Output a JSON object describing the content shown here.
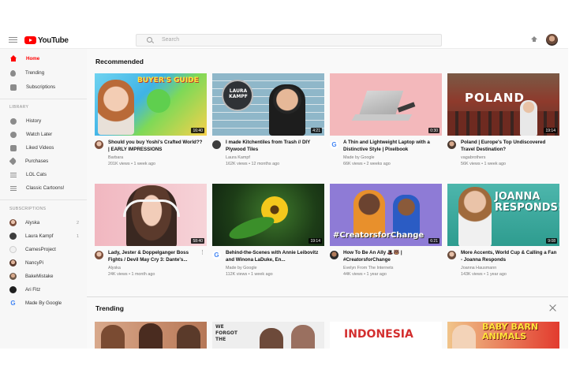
{
  "header": {
    "logo_text": "YouTube",
    "search_placeholder": "Search",
    "icons": [
      "menu-icon",
      "search-icon",
      "upload-icon",
      "avatar"
    ]
  },
  "colors": {
    "brand_red": "#ff0000",
    "sidebar_bg": "#f7f7f7",
    "text": "#111111",
    "muted": "#777777"
  },
  "sidebar": {
    "main": [
      {
        "label": "Home",
        "icon": "home-icon",
        "active": true
      },
      {
        "label": "Trending",
        "icon": "flame-icon"
      },
      {
        "label": "Subscriptions",
        "icon": "subscriptions-icon"
      }
    ],
    "library_heading": "LIBRARY",
    "library": [
      {
        "label": "History",
        "icon": "history-icon"
      },
      {
        "label": "Watch Later",
        "icon": "clock-icon"
      },
      {
        "label": "Liked Videos",
        "icon": "thumb-up-icon"
      },
      {
        "label": "Purchases",
        "icon": "tag-icon"
      },
      {
        "label": "LOL Cats",
        "icon": "playlist-icon"
      },
      {
        "label": "Classic Cartoons!",
        "icon": "playlist-icon"
      }
    ],
    "subscriptions_heading": "SUBSCRIPTIONS",
    "subscriptions": [
      {
        "label": "Alyska",
        "badge": "2"
      },
      {
        "label": "Laura Kampf",
        "badge": "1"
      },
      {
        "label": "CamesProject",
        "badge": ""
      },
      {
        "label": "NancyPi",
        "badge": ""
      },
      {
        "label": "BakeMistake",
        "badge": ""
      },
      {
        "label": "Ari Fitz",
        "badge": ""
      },
      {
        "label": "Made By Google",
        "badge": ""
      }
    ]
  },
  "recommended": {
    "title": "Recommended",
    "videos": [
      {
        "title": "Should you buy Yoshi's Crafted World?? | EARLY IMPRESSIONS",
        "channel": "Barbara",
        "stats": "201K views • 1 week ago",
        "duration": "16:40",
        "overlay": "BUYER'S GUIDE"
      },
      {
        "title": "I made Kitchentiles from Trash // DIY Plywood Tiles",
        "channel": "Laura Kampf",
        "stats": "162K views • 12 months ago",
        "duration": "4:21",
        "overlay": "LAURA KAMPF"
      },
      {
        "title": "A Thin and Lightweight Laptop with a Distinctive Style | Pixelbook",
        "channel": "Made by Google",
        "stats": "66K views • 2 weeks ago",
        "duration": "0:30",
        "overlay": ""
      },
      {
        "title": "Poland | Europe's Top Undiscovered Travel Destination?",
        "channel": "vagabrothers",
        "stats": "56K views • 1 week ago",
        "duration": "19:14",
        "overlay": "POLAND"
      },
      {
        "title": "Lady, Jester & Doppelganger Boss Fights / Devil May Cry 3: Dante's...",
        "channel": "Alyska",
        "stats": "24K views • 1 month ago",
        "duration": "58:40",
        "overlay": ""
      },
      {
        "title": "Behind-the-Scenes with Annie Leibovitz and Winona LaDuke, En...",
        "channel": "Made by Google",
        "stats": "112K views • 1 week ago",
        "duration": "19:14",
        "overlay": ""
      },
      {
        "title": "How To Be An Ally 🎩🐻 | #CreatorsforChange",
        "channel": "Evelyn From The Internets",
        "stats": "44K views • 1 year ago",
        "duration": "6:21",
        "overlay": "#CreatorsforChange"
      },
      {
        "title": "More Accents, World Cup & Calling a Fan - Joanna Responds",
        "channel": "Joanna Hausmann",
        "stats": "143K views • 1 year ago",
        "duration": "9:08",
        "overlay": "JOANNA RESPONDS!"
      }
    ]
  },
  "trending": {
    "title": "Trending",
    "overlays": [
      "",
      "WE FORGOT THE",
      "INDONESIA",
      "BABY BARN ANIMALS"
    ]
  }
}
